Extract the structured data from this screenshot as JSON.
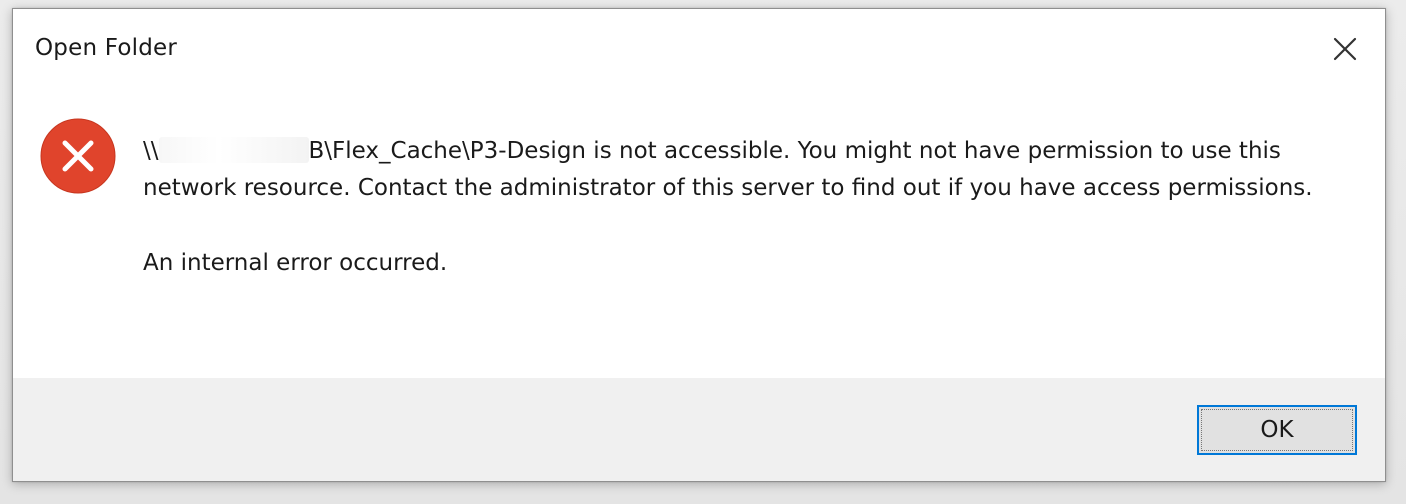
{
  "dialog": {
    "title": "Open Folder",
    "close_icon": "close-icon",
    "error_icon": "error-icon",
    "message": {
      "path_prefix": "\\\\",
      "path_suffix": "B\\Flex_Cache\\P3-Design is not accessible. You might not have permission to use this network resource. Contact the administrator of this server to find out if you have access permissions.",
      "secondary": "An internal error occurred."
    },
    "buttons": {
      "ok_label": "OK"
    }
  },
  "colors": {
    "error_red": "#e0442c",
    "focus_blue": "#0078d7",
    "footer_gray": "#f0f0f0"
  }
}
